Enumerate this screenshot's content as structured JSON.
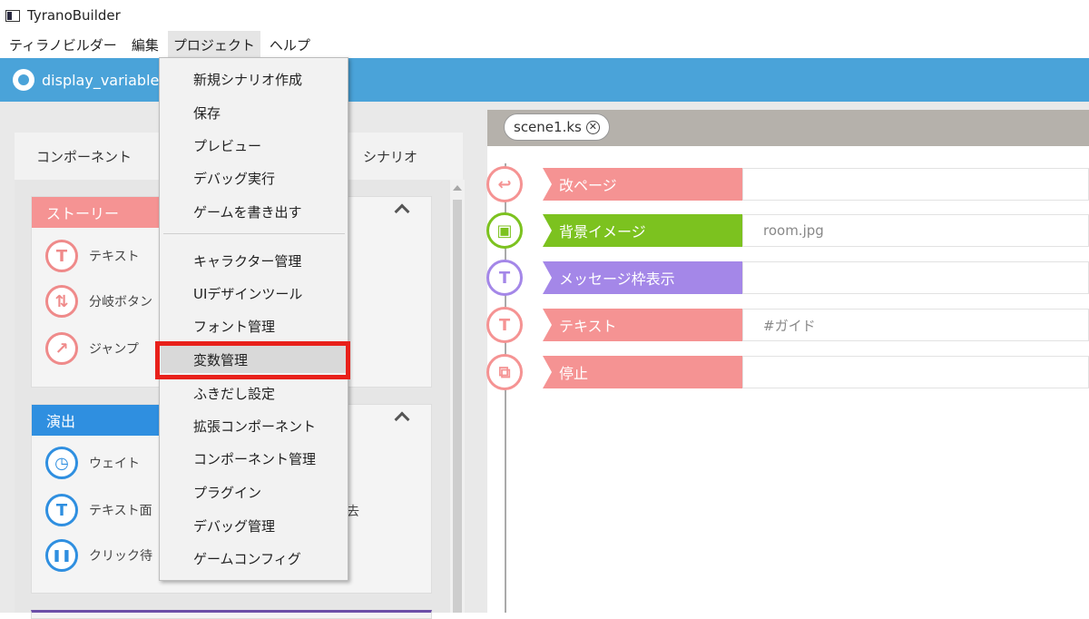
{
  "window": {
    "title": "TyranoBuilder"
  },
  "menubar": {
    "items": [
      {
        "label": "ティラノビルダー",
        "active": false
      },
      {
        "label": "編集",
        "active": false
      },
      {
        "label": "プロジェクト",
        "active": true
      },
      {
        "label": "ヘルプ",
        "active": false
      }
    ]
  },
  "project_bar": {
    "name": "display_variable"
  },
  "left_panel": {
    "tab_components": "コンポーネント",
    "tab_scenario": "シナリオ",
    "sections": [
      {
        "title": "ストーリー",
        "color": "#f59393",
        "items": [
          {
            "icon": "T",
            "icon_name": "text-icon",
            "label": "テキスト"
          },
          {
            "icon": "⇅",
            "icon_name": "branch-icon",
            "label": "分岐ボタン"
          },
          {
            "icon": "↗",
            "icon_name": "jump-icon",
            "label": "ジャンプ"
          }
        ]
      },
      {
        "title": "演出",
        "color": "#2f8fe0",
        "items": [
          {
            "icon": "◷",
            "icon_name": "wait-icon",
            "label": "ウェイト"
          },
          {
            "icon": "T",
            "icon_name": "text-erase-icon",
            "label": "テキスト面",
            "label_right": "去"
          },
          {
            "icon": "❚❚",
            "icon_name": "click-wait-icon",
            "label": "クリック待"
          }
        ]
      }
    ]
  },
  "project_menu": {
    "items": [
      {
        "label": "新規シナリオ作成"
      },
      {
        "label": "保存"
      },
      {
        "label": "プレビュー"
      },
      {
        "label": "デバッグ実行"
      },
      {
        "label": "ゲームを書き出す"
      },
      {
        "label": "キャラクター管理"
      },
      {
        "label": "UIデザインツール"
      },
      {
        "label": "フォント管理"
      },
      {
        "label": "変数管理",
        "highlighted": true
      },
      {
        "label": "ふきだし設定"
      },
      {
        "label": "拡張コンポーネント"
      },
      {
        "label": "コンポーネント管理"
      },
      {
        "label": "プラグイン"
      },
      {
        "label": "デバッグ管理"
      },
      {
        "label": "ゲームコンフィグ"
      }
    ],
    "highlight_color": "#e8201a"
  },
  "editor": {
    "file_tab": "scene1.ks",
    "rows": [
      {
        "icon": "↩",
        "icon_name": "page-break-icon",
        "label": "改ページ",
        "value": "",
        "color": "#f59393"
      },
      {
        "icon": "▣",
        "icon_name": "background-image-icon",
        "label": "背景イメージ",
        "value": "room.jpg",
        "color": "#7cc21f"
      },
      {
        "icon": "T",
        "icon_name": "message-window-icon",
        "label": "メッセージ枠表示",
        "value": "",
        "color": "#a487e8"
      },
      {
        "icon": "T",
        "icon_name": "text-icon",
        "label": "テキスト",
        "value": "#ガイド",
        "color": "#f59393"
      },
      {
        "icon": "⧉",
        "icon_name": "stop-icon",
        "label": "停止",
        "value": "",
        "color": "#f59393"
      }
    ]
  }
}
